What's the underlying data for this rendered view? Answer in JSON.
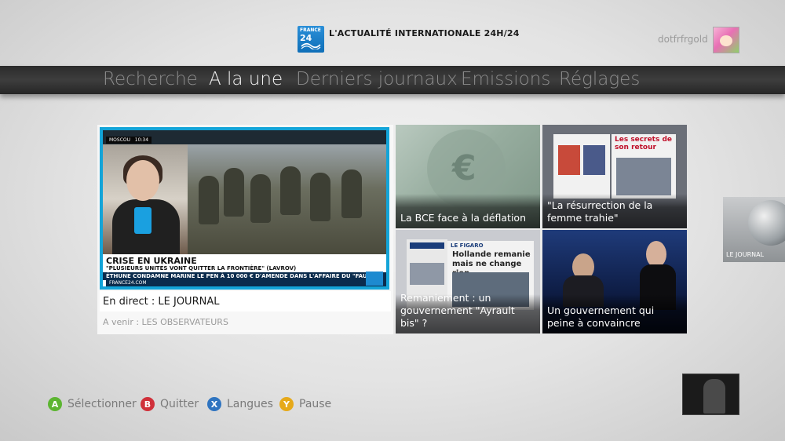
{
  "header": {
    "logo_top": "FRANCE",
    "logo_num": "24",
    "tagline": "L'ACTUALITÉ INTERNATIONALE 24H/24",
    "username": "dotfrfrgold"
  },
  "nav": {
    "items": [
      {
        "label": "Recherche",
        "active": false
      },
      {
        "label": "A la une",
        "active": true
      },
      {
        "label": "Derniers journaux",
        "active": false
      },
      {
        "label": "Emissions",
        "active": false
      },
      {
        "label": "Réglages",
        "active": false
      }
    ]
  },
  "featured": {
    "location": "MOSCOU",
    "time": "10:34",
    "headline": "CRISE EN UKRAINE",
    "subheadline": "\"PLUSIEURS UNITÉS VONT QUITTER LA FRONTIÈRE\" (LAVROV)",
    "ticker": "ÉTHUNE CONDAMNE MARINE LE PEN À 10 000 € D'AMENDE DANS L'AFFAIRE DU \"FAU",
    "site": "FRANCE24.COM",
    "now_label": "En direct : LE JOURNAL",
    "next_label": "A venir : LES OBSERVATEURS"
  },
  "tiles": [
    {
      "caption": "La BCE face à la déflation"
    },
    {
      "caption": "\"La résurrection de la femme trahie\"",
      "paper_headline": "Les secrets de son retour"
    },
    {
      "caption": "Remaniement : un gouvernement \"Ayrault bis\" ?",
      "paper_name": "LE FIGARO",
      "paper_headline": "Hollande remanie mais ne change rien"
    },
    {
      "caption": "Un gouvernement qui peine à convaincre"
    }
  ],
  "side_tile": {
    "label": "LE JOURNAL"
  },
  "hints": [
    {
      "key": "A",
      "label": "Sélectionner",
      "color": "#5cb531"
    },
    {
      "key": "B",
      "label": "Quitter",
      "color": "#d0303a"
    },
    {
      "key": "X",
      "label": "Langues",
      "color": "#2f74c0"
    },
    {
      "key": "Y",
      "label": "Pause",
      "color": "#e6a91a"
    }
  ]
}
